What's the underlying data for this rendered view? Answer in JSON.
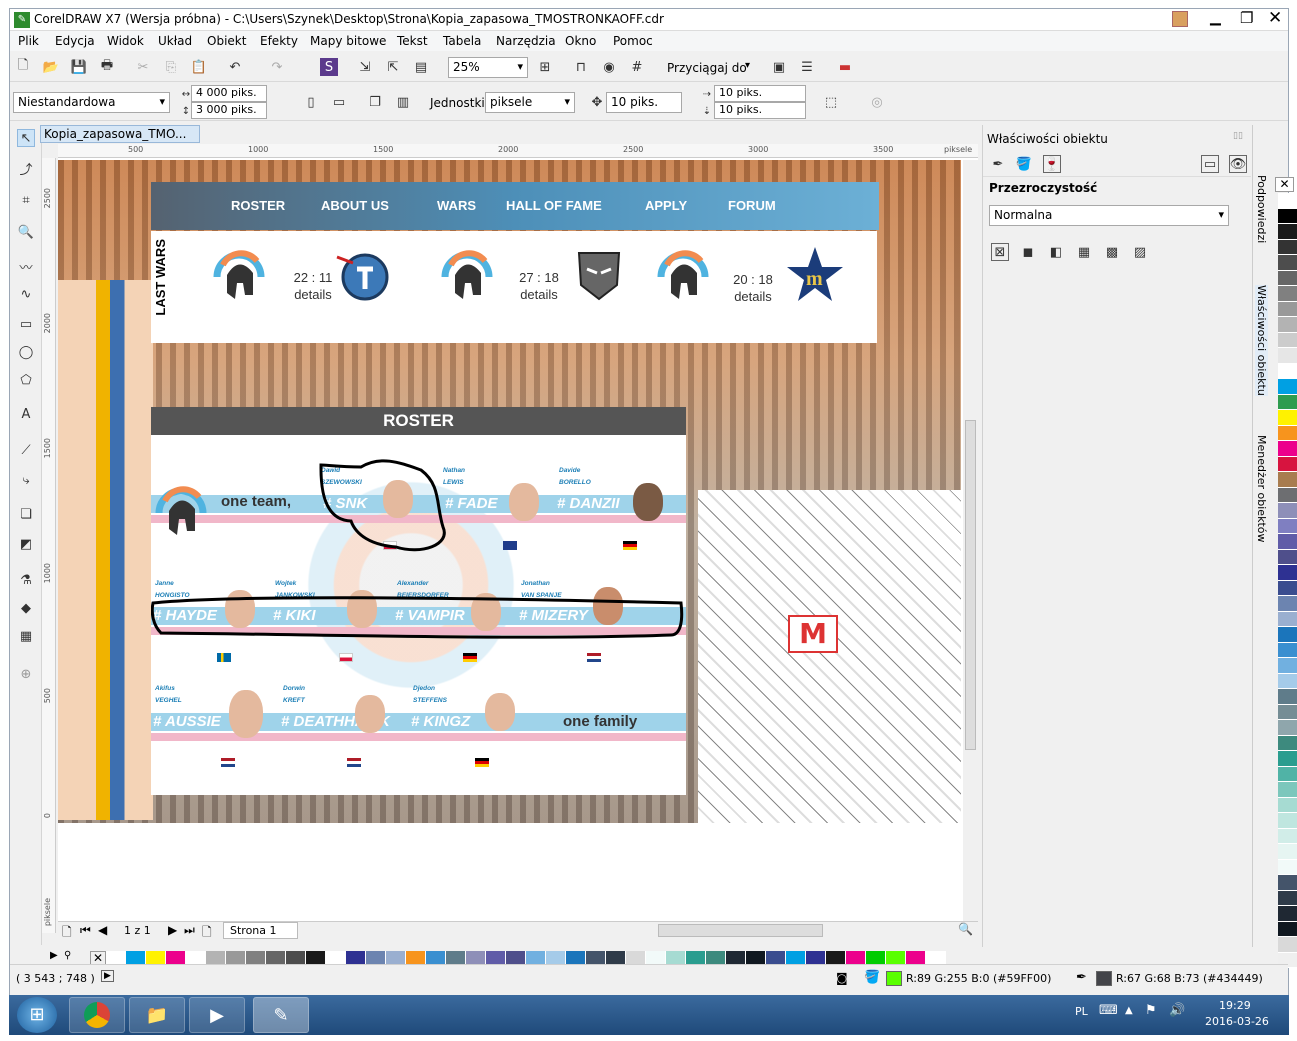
{
  "window": {
    "title": "CorelDRAW X7 (Wersja próbna) - C:\\Users\\Szynek\\Desktop\\Strona\\Kopia_zapasowa_TMOSTRONKAOFF.cdr"
  },
  "menu": [
    "Plik",
    "Edycja",
    "Widok",
    "Układ",
    "Obiekt",
    "Efekty",
    "Mapy bitowe",
    "Tekst",
    "Tabela",
    "Narzędzia",
    "Okno",
    "Pomoc"
  ],
  "toolbar": {
    "zoom": "25%",
    "snap_label": "Przyciągaj do"
  },
  "propertybar": {
    "preset": "Niestandardowa",
    "width": "4 000 piks.",
    "height": "3 000 piks.",
    "units_label": "Jednostki:",
    "units": "piksele",
    "nudge": "10 piks.",
    "dup_x": "10 piks.",
    "dup_y": "10 piks."
  },
  "doc_tab": "Kopia_zapasowa_TMO...",
  "ruler": {
    "h": [
      "500",
      "1000",
      "1500",
      "2000",
      "2500",
      "3000",
      "3500"
    ],
    "unit": "piksele",
    "v": [
      "2500",
      "2000",
      "1500",
      "1000",
      "500",
      "0"
    ],
    "vunit": "piksele"
  },
  "page_nav": {
    "pages": "1 z 1",
    "page_tab": "Strona 1"
  },
  "site": {
    "nav": [
      "ROSTER",
      "ABOUT US",
      "WARS",
      "HALL OF FAME",
      "APPLY",
      "FORUM"
    ],
    "last_wars_label": "LAST WARS",
    "wars": [
      {
        "score": "22 : 11",
        "details": "details"
      },
      {
        "score": "27 : 18",
        "details": "details"
      },
      {
        "score": "20 : 18",
        "details": "details"
      }
    ],
    "roster_title": "ROSTER",
    "one_team": "one team,",
    "one_family": "one family",
    "players": [
      {
        "first": "Dawid",
        "last": "SZEWOWSKI",
        "tag": "# SNK"
      },
      {
        "first": "Nathan",
        "last": "LEWIS",
        "tag": "# FADE"
      },
      {
        "first": "Davide",
        "last": "BORELLO",
        "tag": "# DANZII"
      },
      {
        "first": "Janne",
        "last": "HONGISTO",
        "tag": "# HAYDE"
      },
      {
        "first": "Wojtek",
        "last": "JANKOWSKI",
        "tag": "# KIKI"
      },
      {
        "first": "Alexander",
        "last": "BEIERSDORFER",
        "tag": "# VAMPIR"
      },
      {
        "first": "Jonathan",
        "last": "VAN SPANJE",
        "tag": "# MIZERY"
      },
      {
        "first": "Akifus",
        "last": "VEGHEL",
        "tag": "# AUSSIE"
      },
      {
        "first": "Dorwin",
        "last": "KREFT",
        "tag": "# DEATHHAWK"
      },
      {
        "first": "Djedon",
        "last": "STEFFENS",
        "tag": "# KINGZ"
      }
    ]
  },
  "docker": {
    "title": "Właściwości obiektu",
    "section": "Przezroczystość",
    "mode": "Normalna",
    "side_tabs": [
      "Podpowiedzi",
      "Właściwości obiektu",
      "Menedżer obiektów"
    ]
  },
  "status": {
    "coords": "( 3 543 ; 748   )",
    "fill": "R:89 G:255 B:0 (#59FF00)",
    "outline": "R:67 G:68 B:73 (#434449)",
    "fill_color": "#59FF00",
    "outline_color": "#434449"
  },
  "taskbar": {
    "lang": "PL",
    "time": "19:29",
    "date": "2016-03-26"
  },
  "palette_v": [
    "#ffffff",
    "#000000",
    "#1a1a1a",
    "#333333",
    "#4d4d4d",
    "#666666",
    "#808080",
    "#999999",
    "#b3b3b3",
    "#cccccc",
    "#e6e6e6",
    "#ffffff",
    "#00a0e3",
    "#2e9c4f",
    "#fff200",
    "#f7941d",
    "#ec008c",
    "#d7143f",
    "#a87c4f",
    "#6d6e71",
    "#8e8fb8",
    "#7f7fc1",
    "#605ca8",
    "#4f4f8b",
    "#2e3192",
    "#3a4d8f",
    "#6c84b0",
    "#9aafd0",
    "#1b75bb",
    "#3a8fd0",
    "#71b0e0",
    "#a5cbe9",
    "#5f7c8a",
    "#758d95",
    "#8fa6ac",
    "#3d8a7e",
    "#2a9d8f",
    "#50b3a6",
    "#7cc7bc",
    "#a6dbd2",
    "#bfe6df",
    "#d1ede8",
    "#e6f5f2",
    "#f2faf9",
    "#44546a",
    "#2f3b49",
    "#1f2833",
    "#101820",
    "#d9d9d9",
    "#efefef"
  ],
  "palette_h": [
    "#ffffff",
    "#00a0e3",
    "#fff200",
    "#ec008c",
    "#ffffff",
    "#b3b3b3",
    "#999999",
    "#808080",
    "#666666",
    "#4d4d4d",
    "#1a1a1a",
    "#ffffff",
    "#2e3192",
    "#6c84b0",
    "#9aafd0",
    "#f7941d",
    "#3a8fd0",
    "#5f7c8a",
    "#8e8fb8",
    "#605ca8",
    "#4f4f8b",
    "#71b0e0",
    "#a5cbe9",
    "#1b75bb",
    "#44546a",
    "#2f3b49",
    "#d9d9d9",
    "#f2faf9",
    "#a6dbd2",
    "#2a9d8f",
    "#3d8a7e",
    "#1f2833",
    "#101820",
    "#3a4d8f",
    "#00a0e3",
    "#2e3192",
    "#1a1a1a",
    "#ec008c",
    "#00cc00",
    "#59ff00",
    "#ec008c",
    "#ffffff"
  ]
}
